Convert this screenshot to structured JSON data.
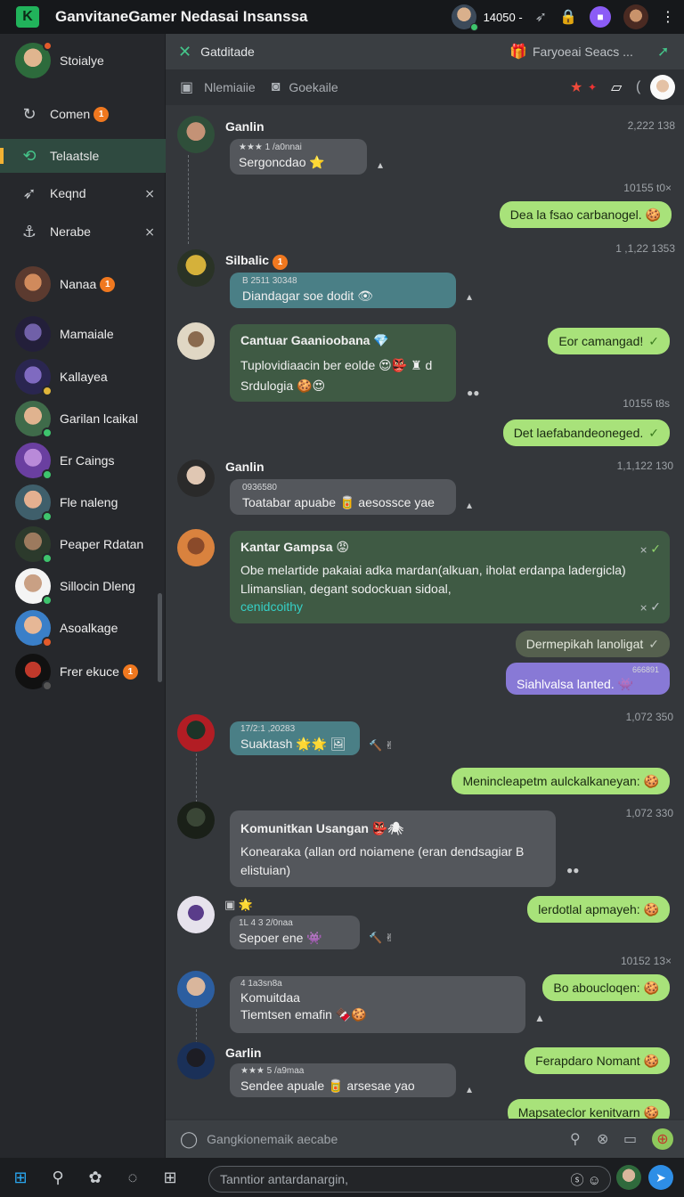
{
  "app": {
    "title": "GanvitaneGamer Nedasai Insanssa",
    "counter": "14050 -"
  },
  "sidebar": {
    "profile_name": "Stoialye",
    "nav": [
      {
        "label": "Comen",
        "badge": "1"
      },
      {
        "label": "Telaatsle",
        "badge": ""
      },
      {
        "label": "Keqnd",
        "badge": ""
      },
      {
        "label": "Nerabe",
        "badge": ""
      }
    ],
    "contacts": [
      {
        "name": "Nanaa",
        "badge": "1"
      },
      {
        "name": "Mamaiale",
        "badge": ""
      },
      {
        "name": "Kallayea",
        "badge": ""
      },
      {
        "name": "Garilan lcaikal",
        "badge": ""
      },
      {
        "name": "Er Caings",
        "badge": ""
      },
      {
        "name": "Fle naleng",
        "badge": ""
      },
      {
        "name": "Peaper Rdatan",
        "badge": ""
      },
      {
        "name": "Sillocin Dleng",
        "badge": ""
      },
      {
        "name": "Asoalkage",
        "badge": ""
      },
      {
        "name": "Frer ekuce",
        "badge": "1"
      }
    ]
  },
  "header": {
    "title": "Gatditade",
    "right": "Faryoeai Seacs ...",
    "tab1": "Nlemiaiie",
    "tab2": "Goekaile"
  },
  "messages": {
    "m1": {
      "name": "Ganlin",
      "time": "2,222  138",
      "meta": "★★★ 1 /a0nnai",
      "text": "Sergoncdao ⭐"
    },
    "t1": "10155  t0×",
    "o1": "Dea la fsao carbanogel.",
    "t2": "1 ,1,22  1353",
    "m2": {
      "name": "Silbalic",
      "badge": "1",
      "meta": "B 2511 30348",
      "text": "Diandagar soe dodit 👁"
    },
    "m3": {
      "title": "Cantuar Gaanioobana 💎",
      "line1": "Tuplovidiaacin ber eolde 😍👺 ♜ d",
      "line2": "Srdulogia 🍪😍"
    },
    "o2": "Eor camangad!",
    "t3": "10155  t8s",
    "o3": "Det laefabandeoneged.",
    "m4": {
      "name": "Ganlin",
      "time": "1,1,122  130",
      "meta": "0936580",
      "text": "Toatabar apuabe 🥫 aesossce yae"
    },
    "m5": {
      "title": "Kantar Gampsa 😡",
      "line1": "Obe melartide pakaiai adka mardan(alkuan, iholat erdanpa ladergicla)",
      "line2": "Llimanslian, degant sodockuan sidoal,",
      "link": "cenidcoithy"
    },
    "o4": "Dermepikah lanoligat",
    "o5": {
      "meta": "666891",
      "text": "Siahlvalsa lanted."
    },
    "t4": "1,072  350",
    "m6": {
      "meta": "17/2:1 ,20283",
      "text": "Suaktash 🌟🌟 🖼"
    },
    "o6": "Menincleapetm aulckalkaneyan:",
    "t5": "1,072  330",
    "m7": {
      "title": "Komunitkan Usangan 👺🕷",
      "line1": "Konearaka (allan ord noiamene (eran dendsagiar B",
      "line2": "elistuian)"
    },
    "o7": "lerdotlal apmayeh:",
    "m8": {
      "meta": "1L  4 3 2/0naa",
      "text": "Sepoer ene 👾"
    },
    "t6": "10152  13×",
    "o8": "Bo aboucloqen:",
    "m9": {
      "meta": "4 1a3sn8a",
      "line1": "Komuitdaa",
      "line2": "Tiemtsen emafin 🍫🍪"
    },
    "m10": {
      "name": "Garlin",
      "meta": "★★★ 5 /a9maa",
      "text": "Sendee apuale 🥫 arsesae yao"
    },
    "o9": "Ferapdaro Nomant",
    "o10": "Mapsateclor kenitvarn"
  },
  "composer": {
    "placeholder": "Gangkionemaik aecabe"
  },
  "taskbar": {
    "input": "Tanntior antardanargin,"
  },
  "colors": {
    "accent": "#21b35b",
    "bubble_out": "#a8e27a",
    "badge": "#f0781f"
  }
}
